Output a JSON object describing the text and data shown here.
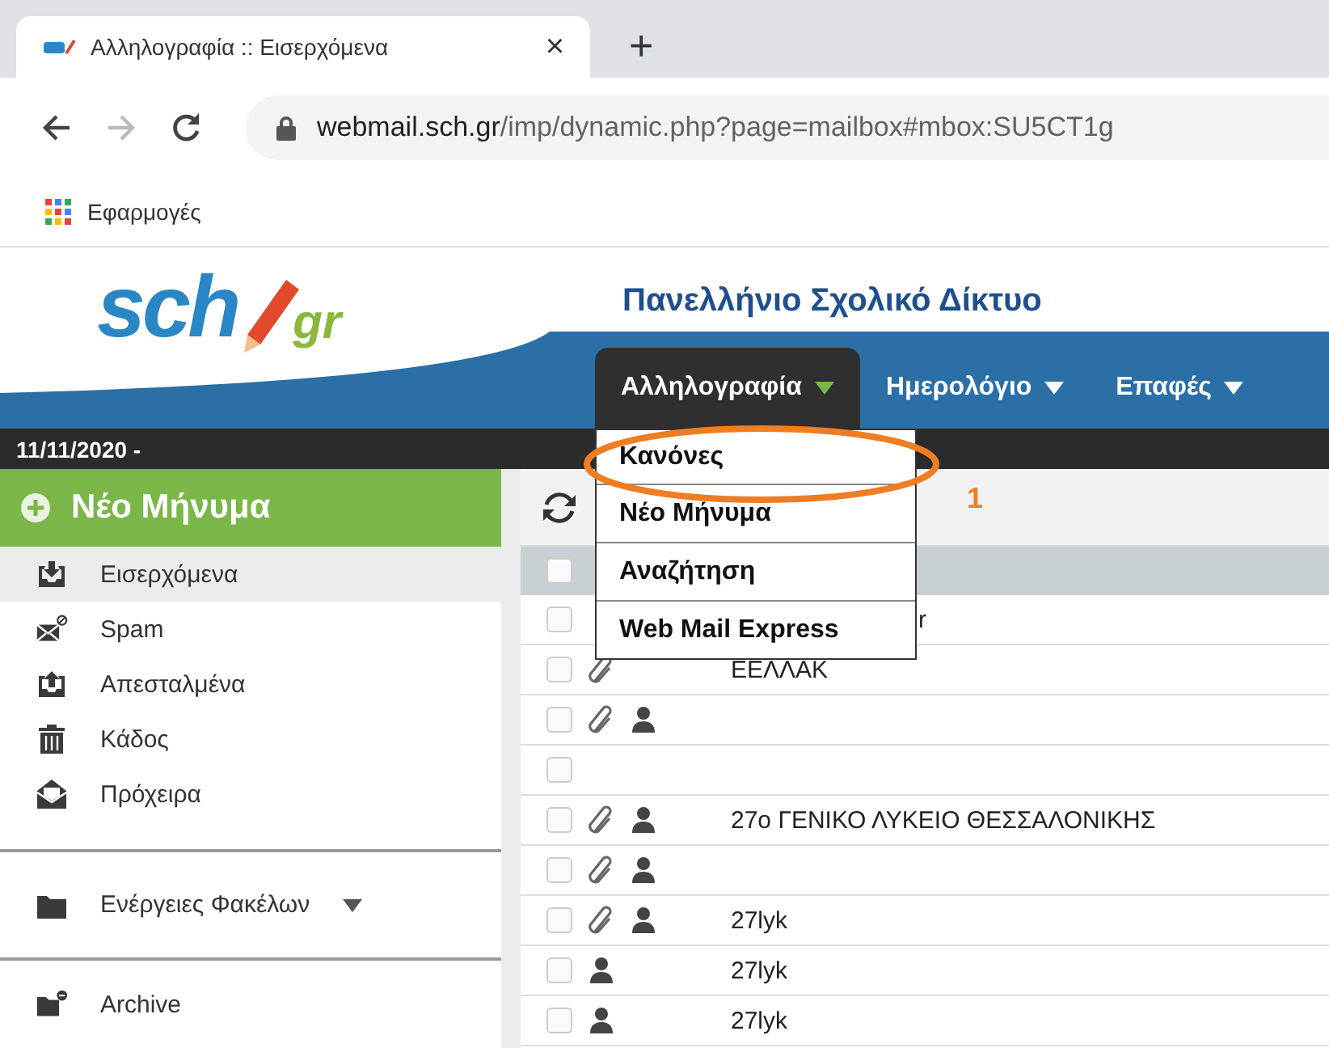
{
  "browser": {
    "tab": {
      "title": "Αλληλογραφία :: Εισερχόμενα",
      "close": "×"
    },
    "new_tab": "+",
    "url": {
      "host": "webmail.sch.gr",
      "path": "/imp/dynamic.php?page=mailbox#mbox:SU5CT1g"
    },
    "bookmarks": [
      "Εφαρμογές"
    ]
  },
  "header": {
    "logo": {
      "main": "sch",
      "suffix": "gr"
    },
    "title": "Πανελλήνιο Σχολικό Δίκτυο",
    "nav": [
      {
        "label": "Αλληλογραφία",
        "selected": true
      },
      {
        "label": "Ημερολόγιο",
        "selected": false
      },
      {
        "label": "Επαφές",
        "selected": false
      }
    ]
  },
  "date": "11/11/2020 -",
  "menu": {
    "items": [
      "Κανόνες",
      "Νέο Μήνυμα",
      "Αναζήτηση",
      "Web Mail Express"
    ],
    "annotation": "1"
  },
  "sidebar": {
    "compose": "Νέο Μήνυμα",
    "folders": [
      {
        "label": "Εισερχόμενα",
        "kind": "inbox",
        "selected": true
      },
      {
        "label": "Spam",
        "kind": "spam",
        "selected": false
      },
      {
        "label": "Απεσταλμένα",
        "kind": "sent",
        "selected": false
      },
      {
        "label": "Κάδος",
        "kind": "trash",
        "selected": false
      },
      {
        "label": "Πρόχειρα",
        "kind": "drafts",
        "selected": false
      }
    ],
    "actions": "Ενέργειες Φακέλων",
    "extra": [
      {
        "label": "Archive",
        "kind": "archive",
        "selected": false
      }
    ]
  },
  "select_all": {
    "checked": false
  },
  "messages": [
    {
      "attachment": false,
      "contact": false,
      "sender": "r",
      "kind": "covered",
      "checked": false
    },
    {
      "attachment": true,
      "contact": false,
      "sender": "ΕΕΛΛΑΚ",
      "kind": "plain",
      "checked": false
    },
    {
      "attachment": true,
      "contact": true,
      "kind": "plain",
      "checked": false
    },
    {
      "attachment": false,
      "contact": false,
      "kind": "plain",
      "checked": false
    },
    {
      "attachment": true,
      "contact": true,
      "sender": "27ο ΓΕΝΙΚΟ ΛΥΚΕΙΟ ΘΕΣΣΑΛΟΝΙΚΗΣ",
      "kind": "plain",
      "checked": false
    },
    {
      "attachment": true,
      "contact": true,
      "kind": "plain",
      "checked": false
    },
    {
      "attachment": true,
      "contact": true,
      "sender": "27lyk",
      "kind": "plain",
      "checked": false
    },
    {
      "attachment": false,
      "contact": true,
      "sender": "27lyk",
      "kind": "plain",
      "checked": false
    },
    {
      "attachment": false,
      "contact": true,
      "sender": "27lyk",
      "kind": "plain",
      "checked": false
    }
  ]
}
